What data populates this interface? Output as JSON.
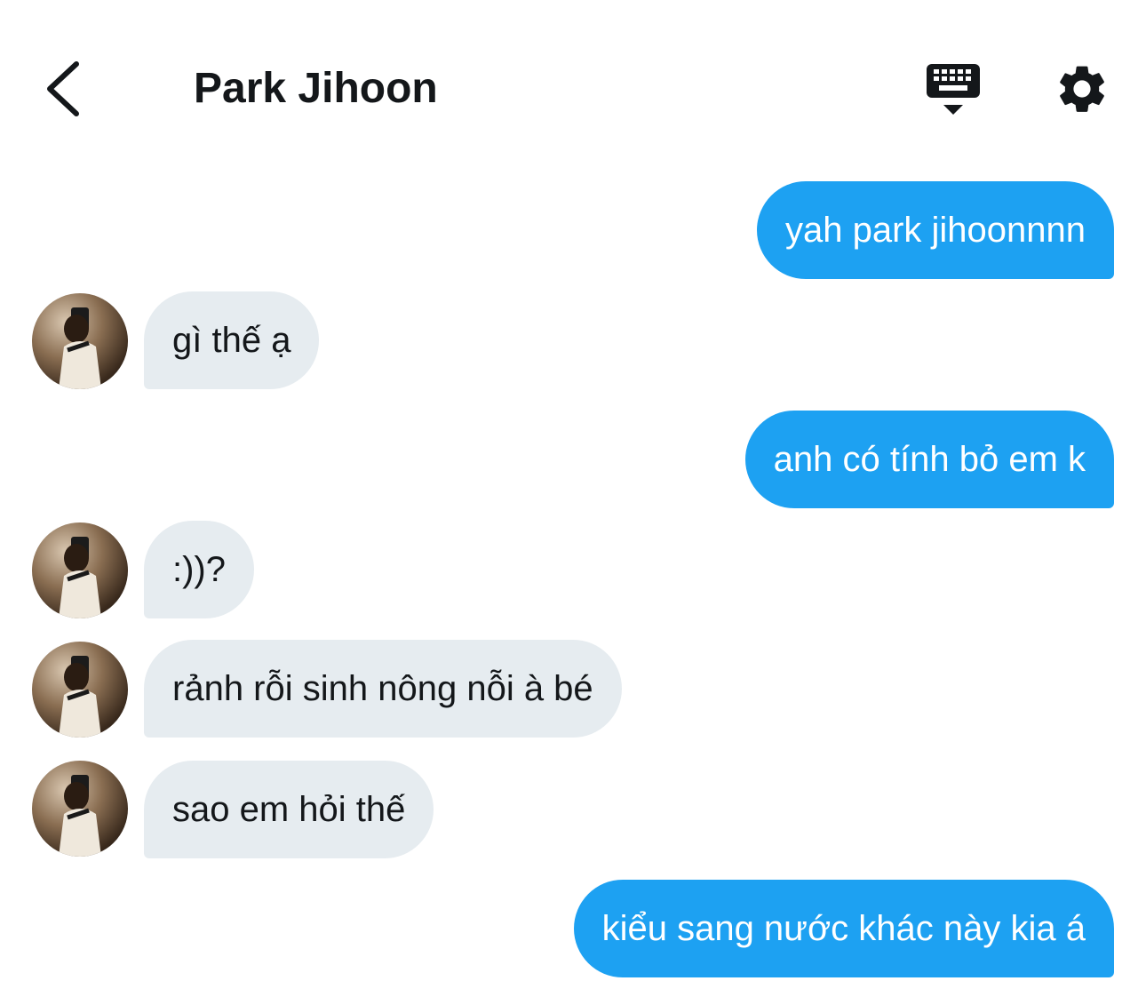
{
  "header": {
    "title": "Park Jihoon",
    "back_icon": "chevron-left-icon",
    "keyboard_icon": "keyboard-icon",
    "settings_icon": "gear-icon"
  },
  "colors": {
    "outgoing_bubble": "#1da1f2",
    "incoming_bubble": "#e6ecf0",
    "text": "#14171a"
  },
  "messages": [
    {
      "direction": "out",
      "text": "yah park jihoonnnn"
    },
    {
      "direction": "in",
      "text": "gì thế ạ"
    },
    {
      "direction": "out",
      "text": "anh có tính bỏ em k"
    },
    {
      "direction": "in",
      "text": ":))?"
    },
    {
      "direction": "in",
      "text": "rảnh rỗi sinh nông nỗi à bé"
    },
    {
      "direction": "in",
      "text": "sao em hỏi thế"
    },
    {
      "direction": "out",
      "text": "kiểu sang nước khác này kia á"
    }
  ]
}
